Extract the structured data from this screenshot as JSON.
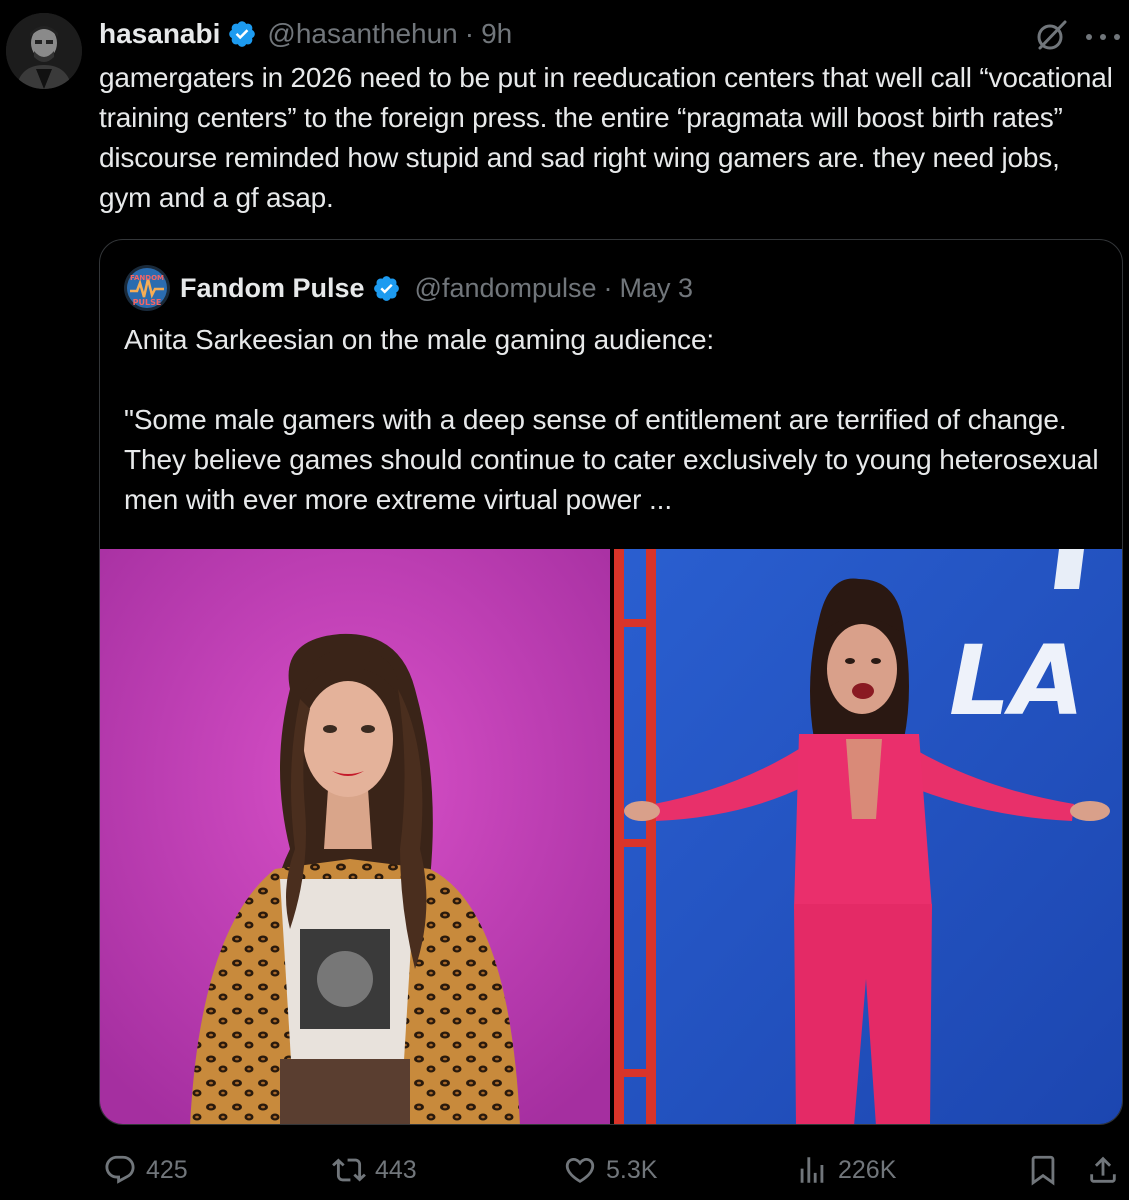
{
  "tweet": {
    "name": "hasanabi",
    "handle": "@hasanthehun",
    "separator": "·",
    "time": "9h",
    "text": "gamergaters in 2026 need to be put in reeducation centers that well call “vocational training centers” to the foreign press. the entire “pragmata will boost birth rates” discourse reminded how stupid and sad right wing gamers are. they need jobs, gym and a gf asap."
  },
  "quote": {
    "name": "Fandom Pulse",
    "handle": "@fandompulse",
    "separator": "·",
    "time": "May 3",
    "avatar_text": "FANDOM PULSE",
    "text": "Anita Sarkeesian on the male gaming audience:\n\n\"Some male gamers with a deep sense of entitlement are terrified of change. They believe games should continue to cater exclusively to young heterosexual men with ever more extreme virtual power ...",
    "photo_right_text": "LA"
  },
  "actions": {
    "replies": "425",
    "reposts": "443",
    "likes": "5.3K",
    "views": "226K"
  },
  "colors": {
    "background": "#000000",
    "text": "#e7e9ea",
    "muted": "#71767b",
    "verified": "#1d9bf0",
    "border": "#333639"
  },
  "icons": [
    "verified-badge-icon",
    "grok-icon",
    "more-icon",
    "reply-icon",
    "repost-icon",
    "like-icon",
    "views-icon",
    "bookmark-icon",
    "share-icon"
  ]
}
